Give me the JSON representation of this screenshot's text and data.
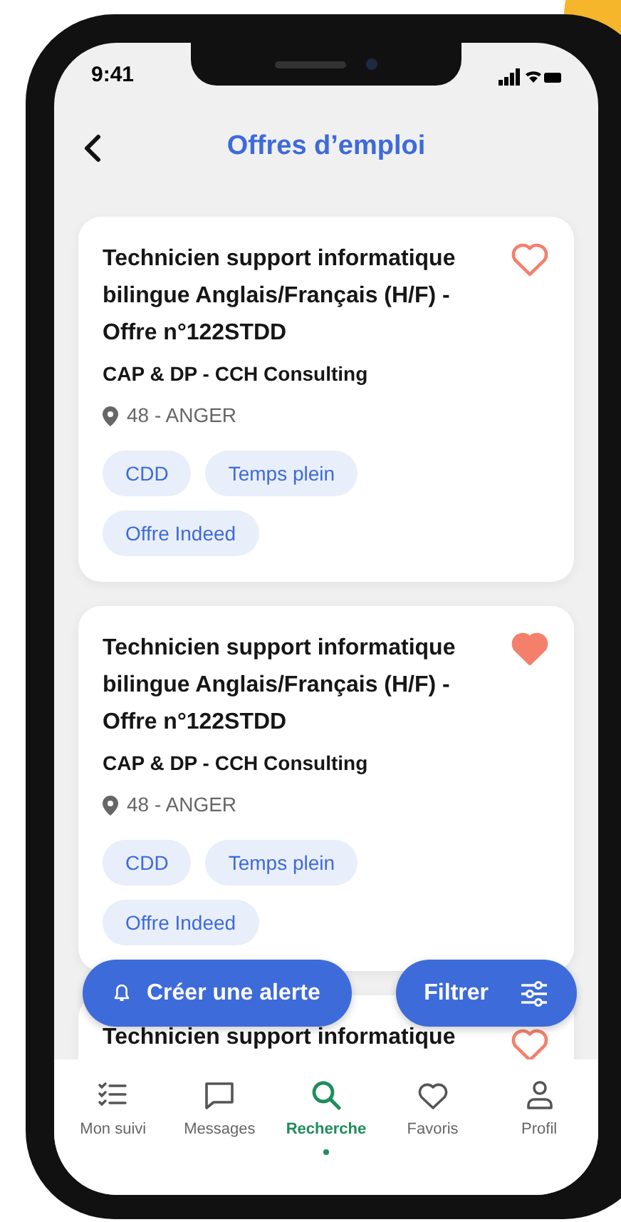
{
  "status_bar": {
    "time": "9:41"
  },
  "header": {
    "title": "Offres d’emploi"
  },
  "offers": [
    {
      "title": "Technicien support informatique bilingue Anglais/Français (H/F) - Offre n°122STDD",
      "company": "CAP & DP - CCH Consulting",
      "location": "48 - ANGER",
      "tags": [
        "CDD",
        "Temps plein",
        "Offre Indeed"
      ],
      "favorite": false
    },
    {
      "title": "Technicien support informatique bilingue Anglais/Français (H/F) - Offre n°122STDD",
      "company": "CAP & DP - CCH Consulting",
      "location": "48 - ANGER",
      "tags": [
        "CDD",
        "Temps plein",
        "Offre Indeed"
      ],
      "favorite": true
    },
    {
      "title": "Technicien support informatique",
      "favorite": false
    }
  ],
  "actions": [
    {
      "kind": "alert",
      "label": "Créer une alerte"
    },
    {
      "kind": "filter",
      "label": "Filtrer"
    }
  ],
  "tabs": [
    {
      "kind": "follow",
      "label": "Mon suivi",
      "selected": false
    },
    {
      "kind": "messages",
      "label": "Messages",
      "selected": false
    },
    {
      "kind": "search",
      "label": "Recherche",
      "selected": true
    },
    {
      "kind": "favorites",
      "label": "Favoris",
      "selected": false
    },
    {
      "kind": "profile",
      "label": "Profil",
      "selected": false
    }
  ]
}
